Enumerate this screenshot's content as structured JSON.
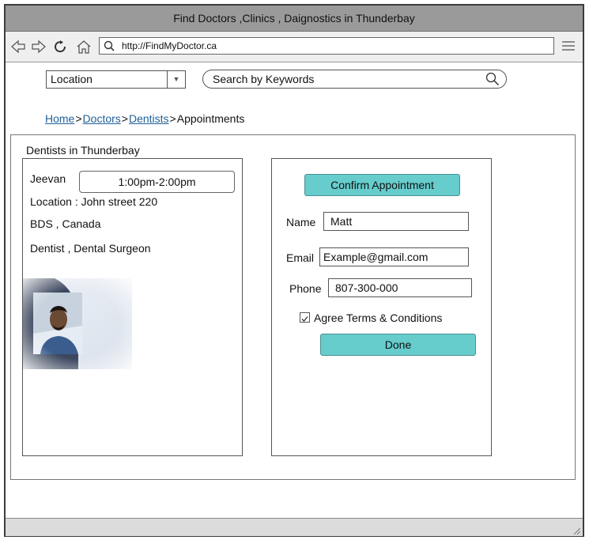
{
  "window": {
    "title": "Find Doctors ,Clinics , Daignostics in Thunderbay"
  },
  "browser": {
    "url": "http://FindMyDoctor.ca"
  },
  "search": {
    "location_value": "Location",
    "keywords_placeholder": "Search by Keywords"
  },
  "breadcrumb": [
    {
      "label": "Home"
    },
    {
      "label": "Doctors"
    },
    {
      "label": "Dentists"
    },
    {
      "label": "Appointments"
    }
  ],
  "panel": {
    "title": "Dentists in Thunderbay"
  },
  "doctor": {
    "name": "Jeevan",
    "time_slot": "1:00pm-2:00pm",
    "location": "Location : John street 220",
    "degree": "BDS , Canada",
    "specialty": "Dentist , Dental Surgeon"
  },
  "form": {
    "confirm_label": "Confirm Appointment",
    "name_label": "Name",
    "name_value": "Matt",
    "email_label": "Email",
    "email_value": "Example@gmail.com",
    "phone_label": "Phone",
    "phone_value": "807-300-000",
    "terms_label": "Agree Terms & Conditions",
    "terms_checked": true,
    "done_label": "Done"
  },
  "colors": {
    "accent_button": "#66cccc",
    "link": "#1f5f98"
  }
}
